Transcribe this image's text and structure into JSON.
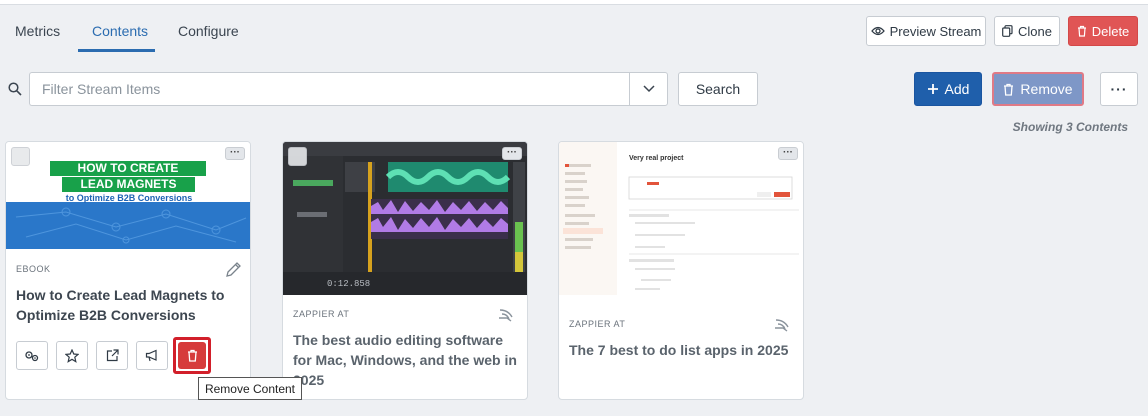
{
  "tabs": [
    {
      "label": "Metrics"
    },
    {
      "label": "Contents"
    },
    {
      "label": "Configure"
    }
  ],
  "header_actions": {
    "preview_label": "Preview Stream",
    "clone_label": "Clone",
    "delete_label": "Delete"
  },
  "filter": {
    "placeholder": "Filter Stream Items",
    "search_label": "Search"
  },
  "toolbar": {
    "add_label": "Add",
    "remove_label": "Remove",
    "more_label": "···"
  },
  "showing_text": "Showing 3 Contents",
  "cards": [
    {
      "type": "EBOOK",
      "title": "How to Create Lead Magnets to Optimize B2B Conversions",
      "thumb_lines": [
        "HOW TO CREATE",
        "LEAD MAGNETS",
        "to Optimize B2B Conversions"
      ]
    },
    {
      "type": "ZAPPIER AT",
      "title": "The best audio editing software for Mac, Windows, and the web in 2025",
      "thumb_timecode": "0:12.858"
    },
    {
      "type": "ZAPPIER AT",
      "title": "The 7 best to do list apps in 2025",
      "thumb_heading": "Very real project"
    }
  ],
  "tooltip": "Remove Content",
  "colors": {
    "accent": "#2b6cb0",
    "primary_button": "#1f5fab",
    "delete": "#e05555",
    "highlight_outline": "#d21f2a"
  }
}
